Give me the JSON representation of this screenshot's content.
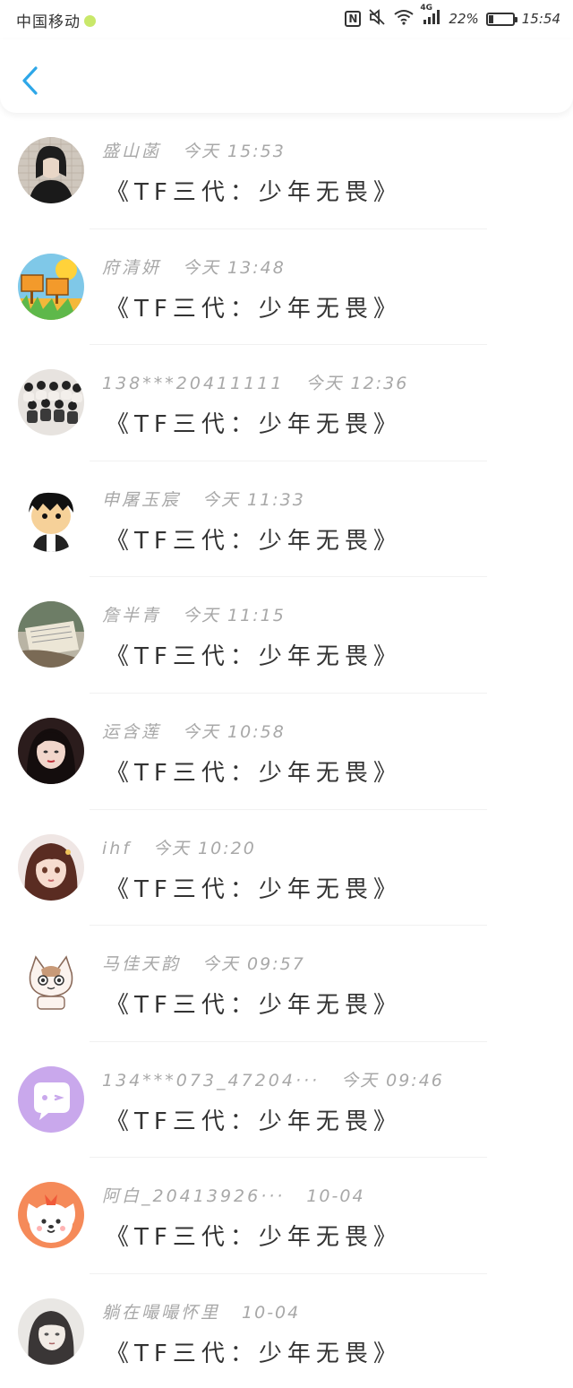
{
  "status_bar": {
    "carrier": "中国移动",
    "network": "4G",
    "battery_percent": "22%",
    "battery_level": 0.22,
    "time": "15:54"
  },
  "header": {
    "back_icon": "chevron-left-icon"
  },
  "colors": {
    "accent": "#2ea7e8",
    "meta_text": "#a8a8a8",
    "message_text": "#333333"
  },
  "list": [
    {
      "name": "盛山菡",
      "date": "今天 15:53",
      "message": "《TF三代：少年无畏》",
      "avatar": "avatar-dark-hair-person"
    },
    {
      "name": "府清妍",
      "date": "今天 13:48",
      "message": "《TF三代：少年无畏》",
      "avatar": "avatar-farm-sign"
    },
    {
      "name": "138***20411111",
      "date": "今天 12:36",
      "message": "《TF三代：少年无畏》",
      "avatar": "avatar-group-photo"
    },
    {
      "name": "申屠玉宸",
      "date": "今天 11:33",
      "message": "《TF三代：少年无畏》",
      "avatar": "avatar-cartoon-boy"
    },
    {
      "name": "詹半青",
      "date": "今天 11:15",
      "message": "《TF三代：少年无畏》",
      "avatar": "avatar-book"
    },
    {
      "name": "运含莲",
      "date": "今天 10:58",
      "message": "《TF三代：少年无畏》",
      "avatar": "avatar-girl-dark"
    },
    {
      "name": "ihf",
      "date": "今天 10:20",
      "message": "《TF三代：少年无畏》",
      "avatar": "avatar-illustrated-girl"
    },
    {
      "name": "马佳天韵",
      "date": "今天 09:57",
      "message": "《TF三代：少年无畏》",
      "avatar": "avatar-cartoon-cat"
    },
    {
      "name": "134***073_47204···",
      "date": "今天 09:46",
      "message": "《TF三代：少年无畏》",
      "avatar": "avatar-default-chat"
    },
    {
      "name": "阿白_20413926···",
      "date": "10-04",
      "message": "《TF三代：少年无畏》",
      "avatar": "avatar-cartoon-dog"
    },
    {
      "name": "躺在嘬嘬怀里",
      "date": "10-04",
      "message": "《TF三代：少年无畏》",
      "avatar": "avatar-sketch-girl"
    }
  ]
}
